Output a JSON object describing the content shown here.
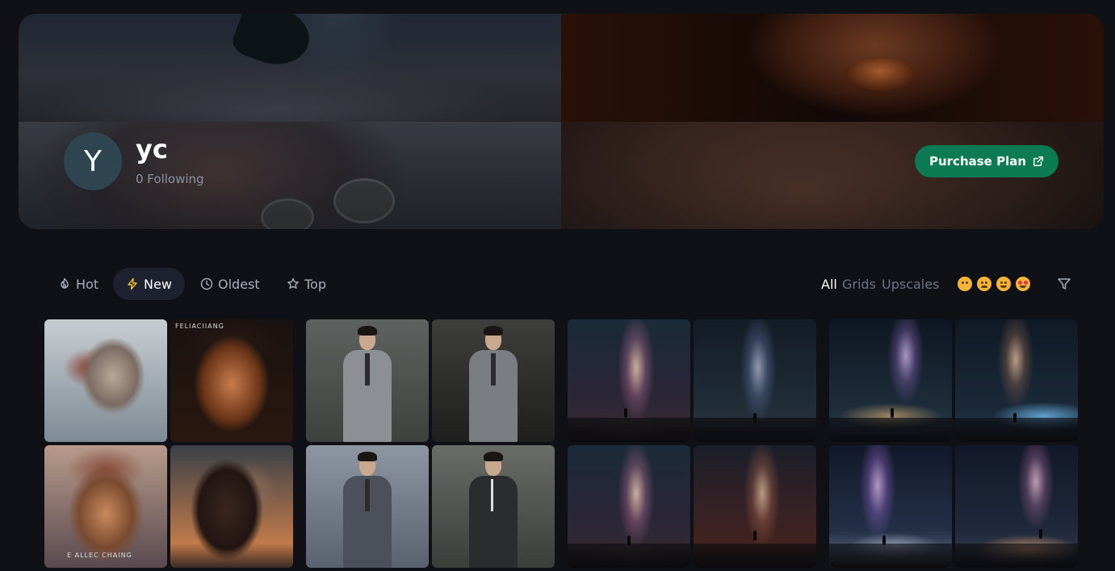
{
  "profile": {
    "avatar_letter": "Y",
    "username": "yc",
    "following": "0 Following",
    "purchase_label": "Purchase Plan"
  },
  "sort_tabs": [
    {
      "label": "Hot",
      "icon": "flame-icon",
      "active": false
    },
    {
      "label": "New",
      "icon": "lightning-icon",
      "active": true
    },
    {
      "label": "Oldest",
      "icon": "clock-icon",
      "active": false
    },
    {
      "label": "Top",
      "icon": "star-icon",
      "active": false
    }
  ],
  "type_filters": [
    {
      "label": "All",
      "active": true
    },
    {
      "label": "Grids",
      "active": false
    },
    {
      "label": "Upscales",
      "active": false
    }
  ],
  "reaction_emojis": [
    "flushed-face",
    "weary-face",
    "grinning-face",
    "heart-eyes-face"
  ],
  "image_captions": {
    "face_b": "FELIACIIANG",
    "face_c": "E ALLEC CHAING"
  },
  "colors": {
    "background": "#0f1117",
    "accent_button": "#0c7a52",
    "active_tab": "#1d2130",
    "avatar": "#2f4552",
    "muted_text": "#6c7485"
  }
}
